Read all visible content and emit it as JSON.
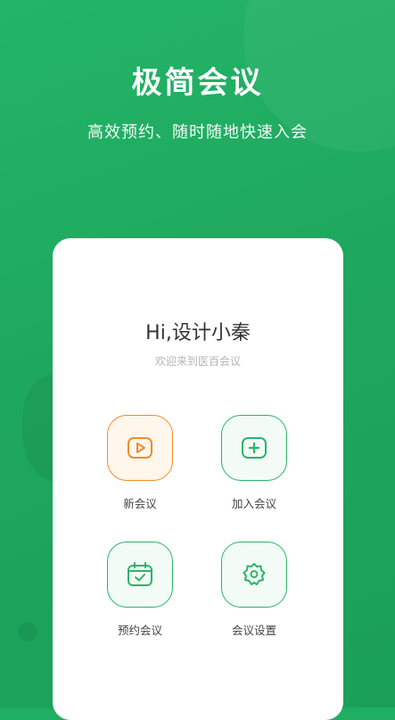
{
  "header": {
    "title": "极简会议",
    "subtitle": "高效预约、随时随地快速入会"
  },
  "card": {
    "greeting": "Hi,设计小秦",
    "welcome": "欢迎来到医百会议"
  },
  "actions": [
    {
      "label": "新会议",
      "icon": "video-play-icon",
      "accent": "#f08c2a"
    },
    {
      "label": "加入会议",
      "icon": "add-square-icon",
      "accent": "#2db36a"
    },
    {
      "label": "预约会议",
      "icon": "calendar-check-icon",
      "accent": "#2db36a"
    },
    {
      "label": "会议设置",
      "icon": "gear-icon",
      "accent": "#2db36a"
    }
  ],
  "colors": {
    "brand_green": "#1fae62",
    "orange": "#f08c2a"
  }
}
